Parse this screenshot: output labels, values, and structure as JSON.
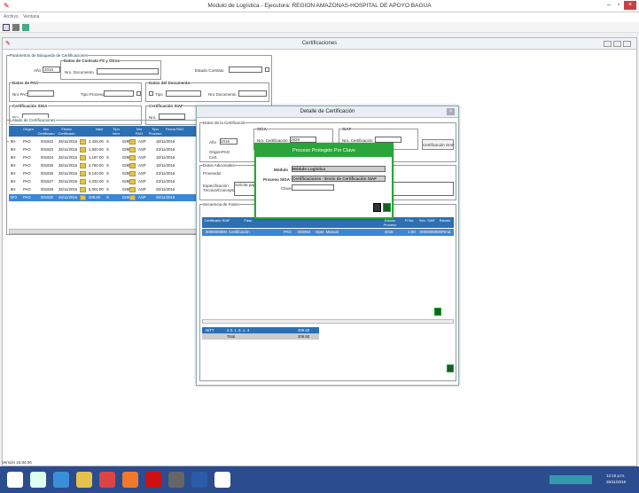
{
  "app": {
    "title": "Módulo de Logística - Ejecutora: REGION AMAZONAS-HOSPITAL DE APOYO BAGUA",
    "menu": [
      "Archivo",
      "Ventana"
    ],
    "version": "Versión 15.84.06"
  },
  "certificaciones": {
    "title": "Certificaciones",
    "search_group": "Parámetros de Búsqueda de Certificaciones",
    "anio_label": "Año",
    "anio_value": "2016",
    "contrato_group": "Datos de Contrato FS y Otros",
    "nro_documento_label": "Nro. Documento",
    "estado_contrato_label": "Estado Contrato",
    "pao_group": "Datos de PAO",
    "nro_pao_label": "Nro PAO",
    "tipo_proceso_label": "Tipo Proceso",
    "documento_group": "Datos del Documento",
    "tipo_label": "Tipo",
    "nro_documento2_label": "Nro Documento",
    "siga_group": "Certificación SIGA",
    "nro_label": "Nro.",
    "siaf_group": "Certificación SIAF",
    "nro2_label": "Nro.",
    "listado_group": "Listado de Certificaciones",
    "columns": [
      "Origen",
      "Nro Certificado",
      "Fecha Certificado",
      "",
      "Valor",
      "Tipo Item",
      "",
      "Nro PAO",
      "Tipo Proceso",
      "Fecha PAO"
    ],
    "rows": [
      [
        "PAO",
        "001922",
        "25/11/2016",
        "2,425.00",
        "S",
        "02957",
        "ASP",
        "18/11/2016"
      ],
      [
        "PAO",
        "001923",
        "25/11/2016",
        "1,920.00",
        "S",
        "02964",
        "ASP",
        "23/11/2016"
      ],
      [
        "PAO",
        "001924",
        "25/11/2016",
        "1,197.00",
        "S",
        "02969",
        "ASP",
        "18/11/2016"
      ],
      [
        "PAO",
        "001925",
        "25/11/2016",
        "2,760.00",
        "S",
        "02954",
        "ASP",
        "18/11/2016"
      ],
      [
        "PAO",
        "001926",
        "25/11/2016",
        "9,140.00",
        "S",
        "02965",
        "ASP",
        "23/11/2016"
      ],
      [
        "PAO",
        "001927",
        "25/11/2016",
        "4,032.00",
        "S",
        "02968",
        "ASP",
        "23/11/2016"
      ],
      [
        "PAO",
        "001928",
        "25/11/2016",
        "5,001.00",
        "S",
        "02967",
        "ASP",
        "25/11/2016"
      ],
      [
        "PAO",
        "001930",
        "25/11/2016",
        "209.50",
        "S",
        "02966",
        "ASP",
        "25/11/2016"
      ]
    ],
    "row_prefix": [
      "8H",
      "8H",
      "8H",
      "8H",
      "8H",
      "8H",
      "8H",
      "0F2"
    ]
  },
  "detalle": {
    "title": "Detalle de Certificación",
    "datos_group": "Datos de la Certificación",
    "siga_group": "SIGA",
    "siaf_group": "SIAF",
    "anio_label": "Año",
    "anio_value": "2016",
    "nro_cert_label": "Nro. Certificación",
    "nro_cert_value": "2929",
    "nro_cert_siaf_label": "Nro. Certificación",
    "origen_label": "Origen",
    "origen_value": "PAO",
    "cert_label": "Cert.",
    "certificacion_siaf_button": "Certificación SIAF",
    "adicionales_group": "Datos Adicionales",
    "proveedor_label": "Proveedor",
    "especificacion_label": "Especificación Técnica/Concepto",
    "especificacion_value": "Solicita pago a",
    "secuencia_group": "Secuencia de Fases",
    "fase_columns": [
      "Certificado SIAF",
      "Fase",
      "",
      "",
      "",
      "Estado Proceso",
      "Fl No.",
      "Sec. SIAF",
      "Estado"
    ],
    "fase_row": [
      "0000000000",
      "Certificación",
      "PAO",
      "002963",
      "Oper. Manual",
      "2016",
      "1-00",
      "0000000000",
      "Pend."
    ],
    "total_row": [
      "NITT",
      "2.3. 1. 6. 1. 4",
      "209.50"
    ],
    "total_label": "Total",
    "total_value": "209.50"
  },
  "clave": {
    "title": "Proceso Protegido Por Clave",
    "modulo_label": "Módulo",
    "modulo_value": "Módulo Logística",
    "proceso_label": "Proceso SIGA",
    "proceso_value": "Certificaciones - Envío de Certificación SIAF",
    "clave_label": "Clave"
  },
  "taskbar": {
    "time": "12:10 p.m.",
    "date": "26/11/2016"
  }
}
